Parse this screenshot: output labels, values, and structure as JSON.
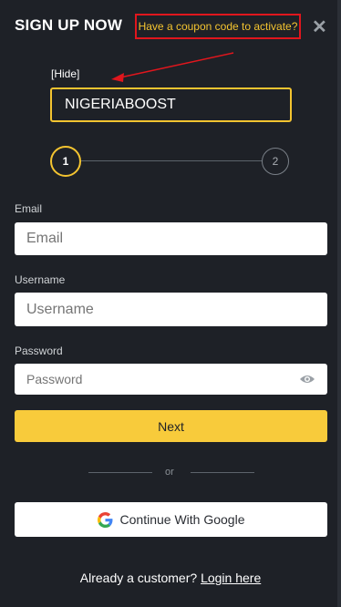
{
  "header": {
    "title": "SIGN UP NOW",
    "coupon_prompt": "Have a coupon code to activate?",
    "close_icon": "close-icon"
  },
  "coupon": {
    "hide_label": "[Hide]",
    "value": "NIGERIABOOST"
  },
  "steps": {
    "step1": "1",
    "step2": "2",
    "current": 1
  },
  "form": {
    "email_label": "Email",
    "email_placeholder": "Email",
    "username_label": "Username",
    "username_placeholder": "Username",
    "password_label": "Password",
    "password_placeholder": "Password",
    "password_toggle_icon": "eye-icon"
  },
  "actions": {
    "next_label": "Next",
    "or_label": "or",
    "google_label": "Continue With Google",
    "google_icon": "google-icon"
  },
  "footer": {
    "prompt": "Already a customer?",
    "login_label": "Login here"
  },
  "colors": {
    "background": "#1e2127",
    "accent": "#f8cb3b",
    "annotation": "#e0161d"
  }
}
